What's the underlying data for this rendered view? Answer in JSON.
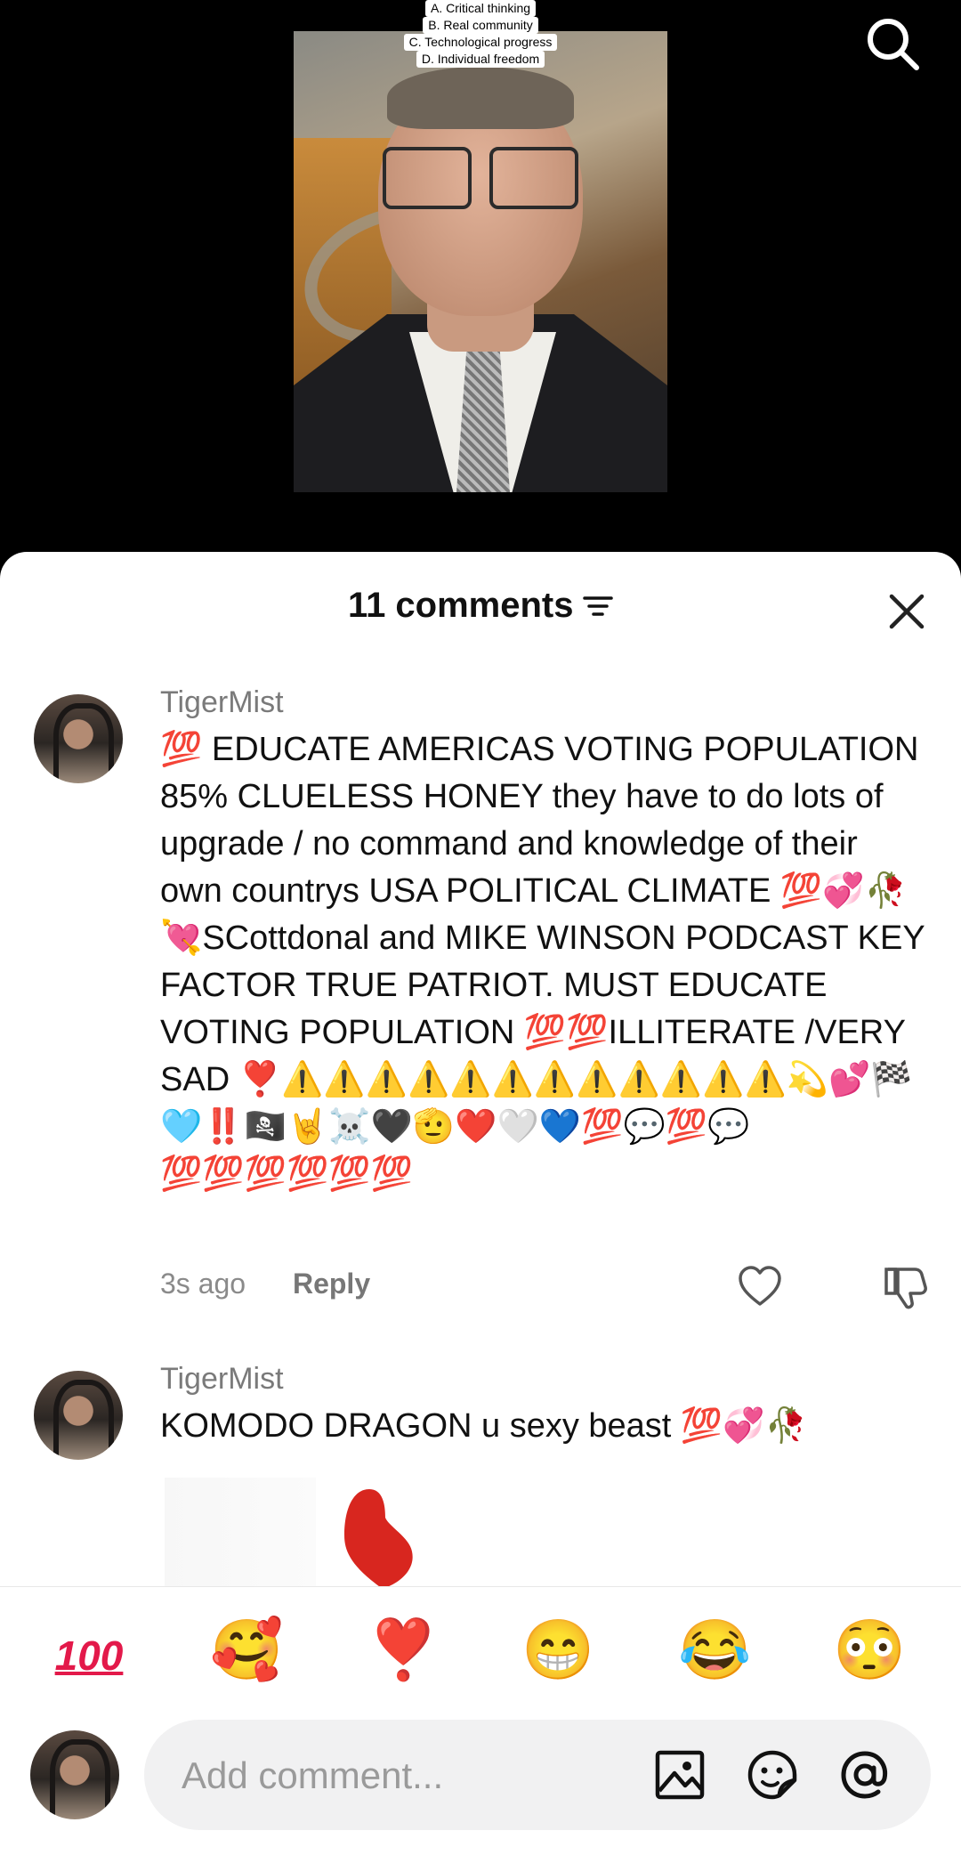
{
  "quiz": {
    "options": [
      "A. Critical thinking",
      "B. Real community",
      "C. Technological progress",
      "D. Individual freedom"
    ]
  },
  "icons": {
    "search": "search-icon",
    "sort": "sort-filter-icon",
    "close": "close-icon",
    "like": "heart-outline-icon",
    "dislike": "thumbs-down-icon",
    "image": "image-icon",
    "sticker": "emoji-sticker-icon",
    "mention": "at-mention-icon"
  },
  "header": {
    "title": "11 comments"
  },
  "comments": [
    {
      "username": "TigerMist",
      "text": "💯 EDUCATE AMERICAS VOTING POPULATION 85% CLUELESS HONEY they have to do lots of upgrade / no command and knowledge of their own countrys USA POLITICAL CLIMATE 💯💞🥀💘SCottdonal and MIKE WINSON PODCAST KEY FACTOR TRUE PATRIOT. MUST EDUCATE VOTING POPULATION 💯💯ILLITERATE /VERY SAD ❣️⚠️⚠️⚠️⚠️⚠️⚠️⚠️⚠️⚠️⚠️⚠️⚠️💫💕🏁🩵‼️🏴‍☠️🤘☠️🖤🫡❤️🤍💙💯💬💯💬💯💯💯💯💯💯",
      "time": "3s ago",
      "reply": "Reply"
    },
    {
      "username": "TigerMist",
      "text": "KOMODO DRAGON u sexy beast 💯💞🥀"
    }
  ],
  "emoji_bar": {
    "hundred": "100",
    "emojis": [
      "🥰",
      "❣️",
      "😁",
      "😂",
      "😳"
    ]
  },
  "composer": {
    "placeholder": "Add comment..."
  },
  "colors": {
    "accent": "#e3194a",
    "sheet_bg": "#ffffff",
    "muted_text": "#8a8a8a"
  }
}
